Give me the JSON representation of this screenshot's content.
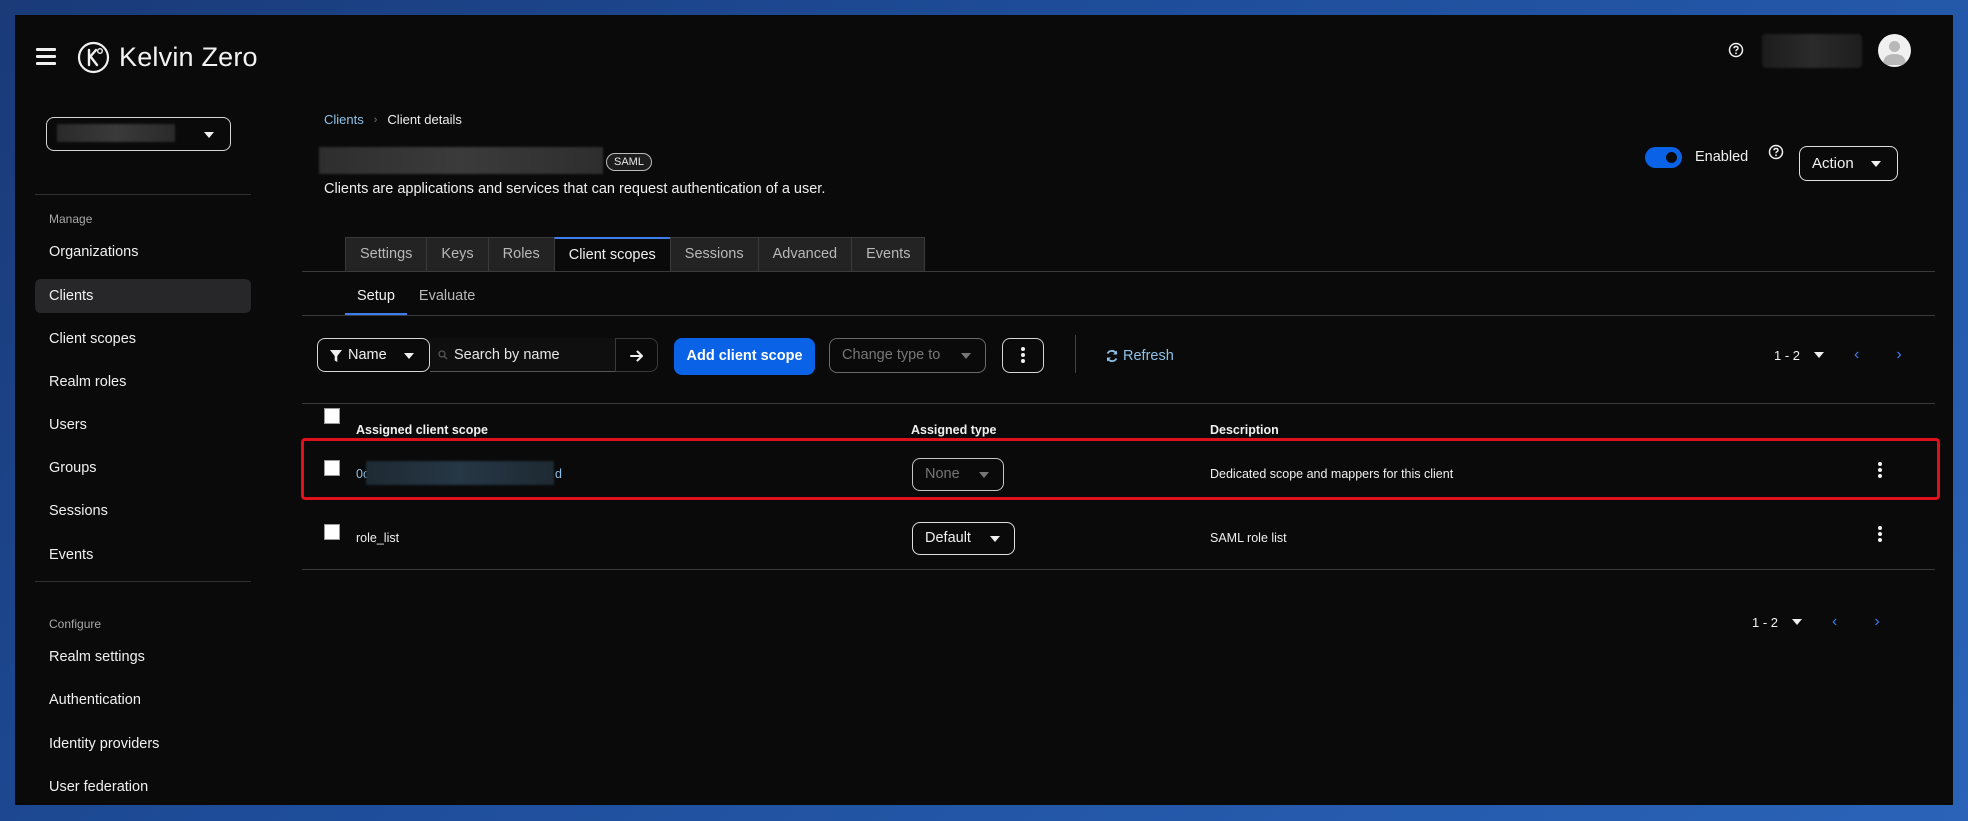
{
  "app": {
    "brand": "Kelvin Zero",
    "colors": {
      "accent": "#0a63e6",
      "link": "#8fc1e8",
      "highlight": "#e0101c"
    }
  },
  "header": {
    "menu_icon": "hamburger-icon",
    "help_icon": "question-circle-icon",
    "avatar_icon": "user-avatar-icon"
  },
  "sidebar": {
    "realm_selector_icon": "caret-down-icon",
    "manage_title": "Manage",
    "manage_items": [
      {
        "label": "Organizations",
        "active": false
      },
      {
        "label": "Clients",
        "active": true
      },
      {
        "label": "Client scopes",
        "active": false
      },
      {
        "label": "Realm roles",
        "active": false
      },
      {
        "label": "Users",
        "active": false
      },
      {
        "label": "Groups",
        "active": false
      },
      {
        "label": "Sessions",
        "active": false
      },
      {
        "label": "Events",
        "active": false
      }
    ],
    "configure_title": "Configure",
    "configure_items": [
      {
        "label": "Realm settings"
      },
      {
        "label": "Authentication"
      },
      {
        "label": "Identity providers"
      },
      {
        "label": "User federation"
      }
    ]
  },
  "breadcrumb": {
    "parent": "Clients",
    "current": "Client details"
  },
  "client": {
    "protocol_badge": "SAML",
    "description": "Clients are applications and services that can request authentication of a user.",
    "enabled_label": "Enabled",
    "enabled": true,
    "action_label": "Action"
  },
  "tabs": [
    {
      "label": "Settings",
      "active": false
    },
    {
      "label": "Keys",
      "active": false
    },
    {
      "label": "Roles",
      "active": false
    },
    {
      "label": "Client scopes",
      "active": true
    },
    {
      "label": "Sessions",
      "active": false
    },
    {
      "label": "Advanced",
      "active": false
    },
    {
      "label": "Events",
      "active": false
    }
  ],
  "subtabs": [
    {
      "label": "Setup",
      "active": true
    },
    {
      "label": "Evaluate",
      "active": false
    }
  ],
  "toolbar": {
    "filter_label": "Name",
    "search_placeholder": "Search by name",
    "add_label": "Add client scope",
    "change_type_label": "Change type to",
    "refresh_label": "Refresh",
    "pagination": "1 - 2"
  },
  "table": {
    "headers": [
      "Assigned client scope",
      "Assigned type",
      "Description"
    ],
    "rows": [
      {
        "scope_prefix": "0o",
        "scope_suffix": "d",
        "type": "None",
        "description": "Dedicated scope and mappers for this client"
      },
      {
        "scope": "role_list",
        "type": "Default",
        "description": "SAML role list"
      }
    ]
  },
  "footer_pagination": "1 - 2"
}
